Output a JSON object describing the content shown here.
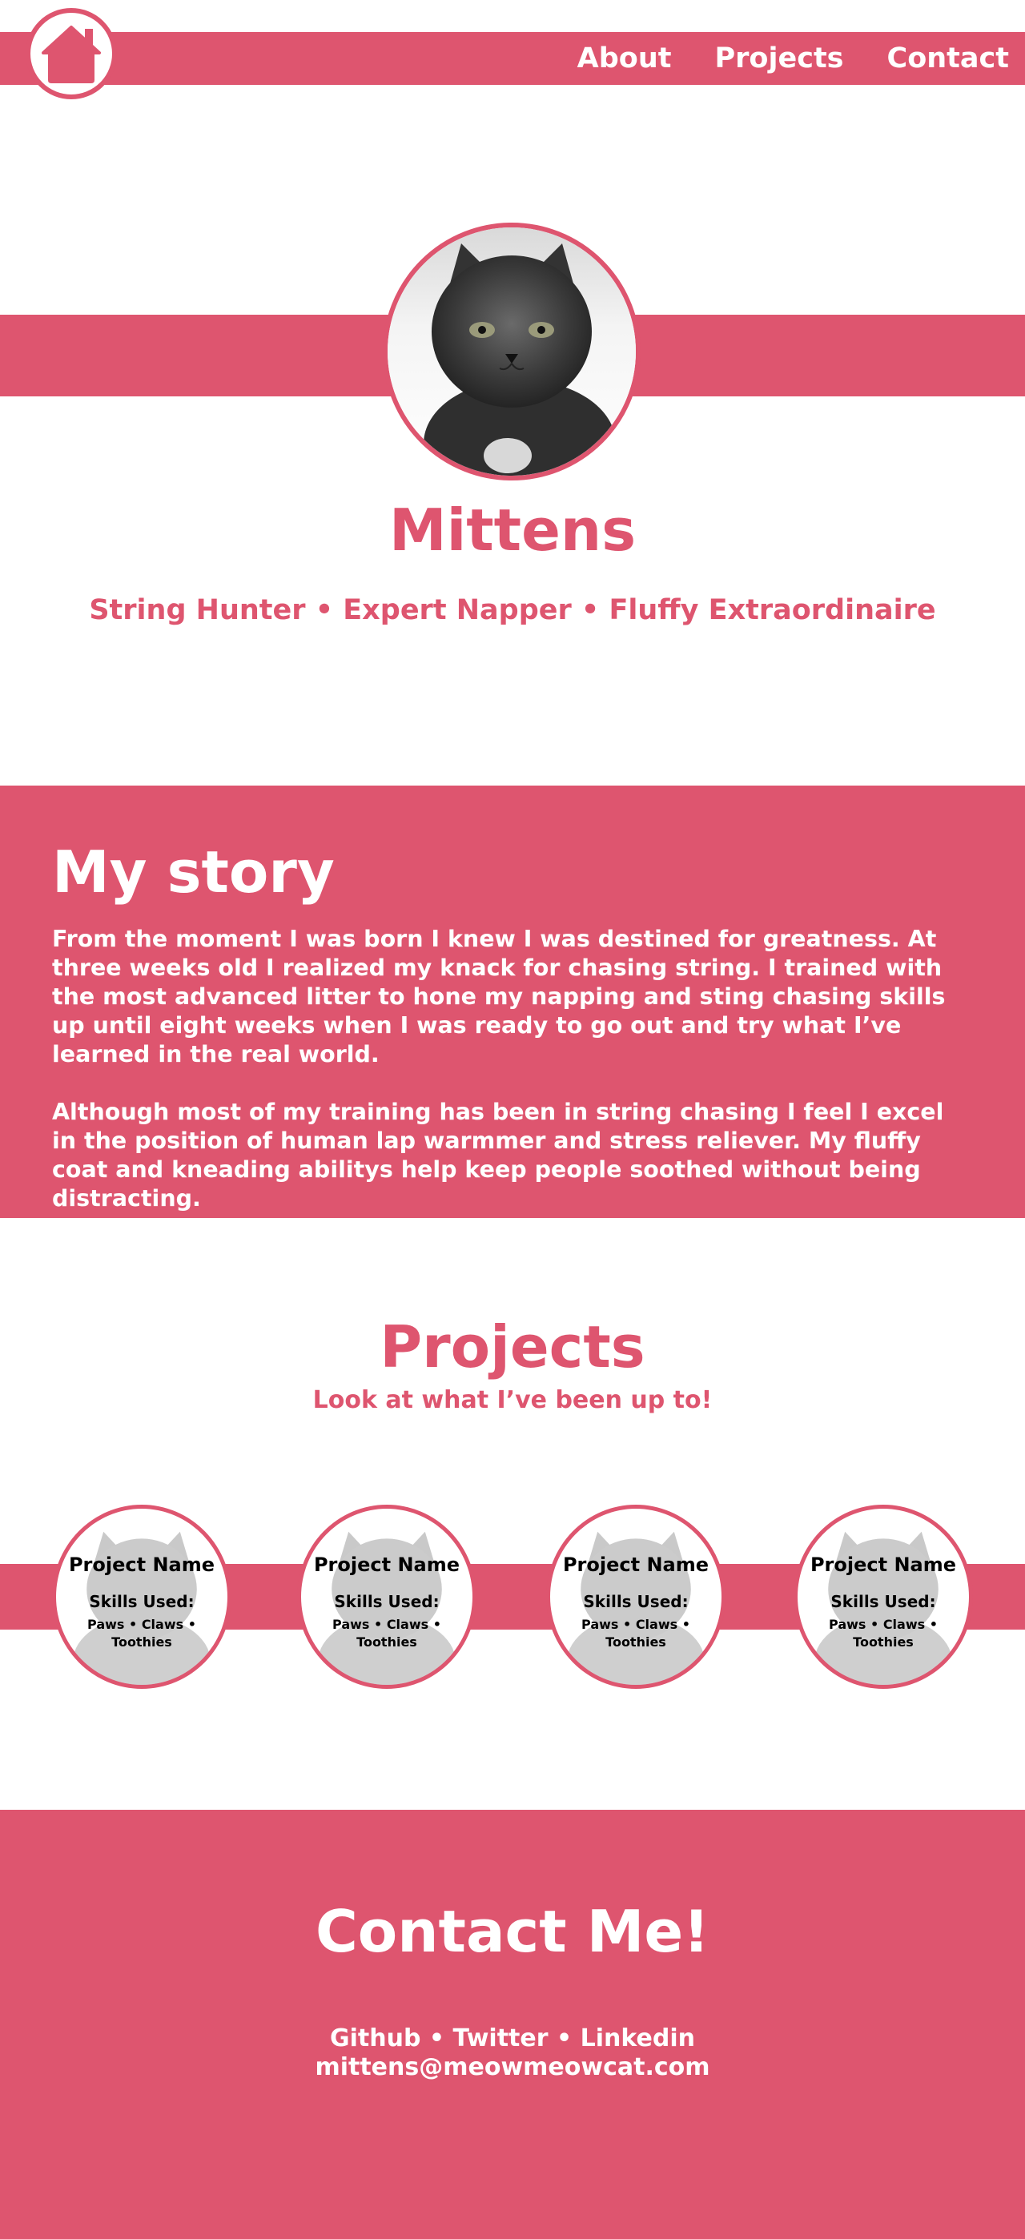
{
  "nav": {
    "home_icon": "house-icon",
    "links": [
      "About",
      "Projects",
      "Contact"
    ]
  },
  "hero": {
    "name": "Mittens",
    "tagline": "String Hunter • Expert Napper • Fluffy Extraordinaire"
  },
  "story": {
    "title": "My story",
    "paragraphs": [
      "From the moment I was born I knew I was destined for greatness. At three weeks old I realized my knack for chasing string. I trained with the most advanced litter to hone my napping and sting chasing skills up until eight weeks when I was ready to go out and try what I’ve learned in the real world.",
      "Although most of my training has been in string chasing I feel I excel in the position of human lap warmmer and stress reliever. My fluffy coat and kneading abilitys help keep people soothed without being distracting."
    ]
  },
  "projects": {
    "title": "Projects",
    "subtitle": "Look at what I’ve been up to!",
    "items": [
      {
        "name": "Project Name",
        "skills_label": "Skills Used:",
        "skills": "Paws • Claws • Toothies"
      },
      {
        "name": "Project Name",
        "skills_label": "Skills Used:",
        "skills": "Paws • Claws • Toothies"
      },
      {
        "name": "Project Name",
        "skills_label": "Skills Used:",
        "skills": "Paws • Claws • Toothies"
      },
      {
        "name": "Project Name",
        "skills_label": "Skills Used:",
        "skills": "Paws • Claws • Toothies"
      }
    ]
  },
  "contact": {
    "title": "Contact Me!",
    "links": [
      "Github",
      "Twitter",
      "Linkedin"
    ],
    "separator": " • ",
    "email": "mittens@meowmeowcat.com"
  },
  "colors": {
    "accent": "#de556f",
    "background": "#ffffff",
    "text_on_accent": "#ffffff"
  }
}
